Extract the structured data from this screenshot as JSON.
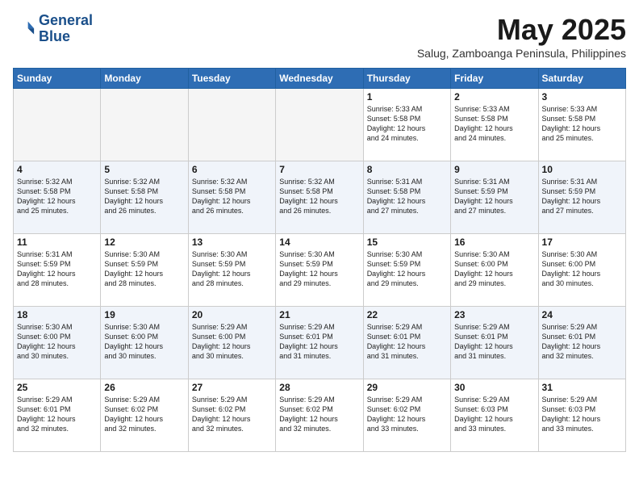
{
  "logo": {
    "line1": "General",
    "line2": "Blue"
  },
  "title": "May 2025",
  "subtitle": "Salug, Zamboanga Peninsula, Philippines",
  "days_of_week": [
    "Sunday",
    "Monday",
    "Tuesday",
    "Wednesday",
    "Thursday",
    "Friday",
    "Saturday"
  ],
  "weeks": [
    [
      {
        "day": "",
        "detail": ""
      },
      {
        "day": "",
        "detail": ""
      },
      {
        "day": "",
        "detail": ""
      },
      {
        "day": "",
        "detail": ""
      },
      {
        "day": "1",
        "detail": "Sunrise: 5:33 AM\nSunset: 5:58 PM\nDaylight: 12 hours\nand 24 minutes."
      },
      {
        "day": "2",
        "detail": "Sunrise: 5:33 AM\nSunset: 5:58 PM\nDaylight: 12 hours\nand 24 minutes."
      },
      {
        "day": "3",
        "detail": "Sunrise: 5:33 AM\nSunset: 5:58 PM\nDaylight: 12 hours\nand 25 minutes."
      }
    ],
    [
      {
        "day": "4",
        "detail": "Sunrise: 5:32 AM\nSunset: 5:58 PM\nDaylight: 12 hours\nand 25 minutes."
      },
      {
        "day": "5",
        "detail": "Sunrise: 5:32 AM\nSunset: 5:58 PM\nDaylight: 12 hours\nand 26 minutes."
      },
      {
        "day": "6",
        "detail": "Sunrise: 5:32 AM\nSunset: 5:58 PM\nDaylight: 12 hours\nand 26 minutes."
      },
      {
        "day": "7",
        "detail": "Sunrise: 5:32 AM\nSunset: 5:58 PM\nDaylight: 12 hours\nand 26 minutes."
      },
      {
        "day": "8",
        "detail": "Sunrise: 5:31 AM\nSunset: 5:58 PM\nDaylight: 12 hours\nand 27 minutes."
      },
      {
        "day": "9",
        "detail": "Sunrise: 5:31 AM\nSunset: 5:59 PM\nDaylight: 12 hours\nand 27 minutes."
      },
      {
        "day": "10",
        "detail": "Sunrise: 5:31 AM\nSunset: 5:59 PM\nDaylight: 12 hours\nand 27 minutes."
      }
    ],
    [
      {
        "day": "11",
        "detail": "Sunrise: 5:31 AM\nSunset: 5:59 PM\nDaylight: 12 hours\nand 28 minutes."
      },
      {
        "day": "12",
        "detail": "Sunrise: 5:30 AM\nSunset: 5:59 PM\nDaylight: 12 hours\nand 28 minutes."
      },
      {
        "day": "13",
        "detail": "Sunrise: 5:30 AM\nSunset: 5:59 PM\nDaylight: 12 hours\nand 28 minutes."
      },
      {
        "day": "14",
        "detail": "Sunrise: 5:30 AM\nSunset: 5:59 PM\nDaylight: 12 hours\nand 29 minutes."
      },
      {
        "day": "15",
        "detail": "Sunrise: 5:30 AM\nSunset: 5:59 PM\nDaylight: 12 hours\nand 29 minutes."
      },
      {
        "day": "16",
        "detail": "Sunrise: 5:30 AM\nSunset: 6:00 PM\nDaylight: 12 hours\nand 29 minutes."
      },
      {
        "day": "17",
        "detail": "Sunrise: 5:30 AM\nSunset: 6:00 PM\nDaylight: 12 hours\nand 30 minutes."
      }
    ],
    [
      {
        "day": "18",
        "detail": "Sunrise: 5:30 AM\nSunset: 6:00 PM\nDaylight: 12 hours\nand 30 minutes."
      },
      {
        "day": "19",
        "detail": "Sunrise: 5:30 AM\nSunset: 6:00 PM\nDaylight: 12 hours\nand 30 minutes."
      },
      {
        "day": "20",
        "detail": "Sunrise: 5:29 AM\nSunset: 6:00 PM\nDaylight: 12 hours\nand 30 minutes."
      },
      {
        "day": "21",
        "detail": "Sunrise: 5:29 AM\nSunset: 6:01 PM\nDaylight: 12 hours\nand 31 minutes."
      },
      {
        "day": "22",
        "detail": "Sunrise: 5:29 AM\nSunset: 6:01 PM\nDaylight: 12 hours\nand 31 minutes."
      },
      {
        "day": "23",
        "detail": "Sunrise: 5:29 AM\nSunset: 6:01 PM\nDaylight: 12 hours\nand 31 minutes."
      },
      {
        "day": "24",
        "detail": "Sunrise: 5:29 AM\nSunset: 6:01 PM\nDaylight: 12 hours\nand 32 minutes."
      }
    ],
    [
      {
        "day": "25",
        "detail": "Sunrise: 5:29 AM\nSunset: 6:01 PM\nDaylight: 12 hours\nand 32 minutes."
      },
      {
        "day": "26",
        "detail": "Sunrise: 5:29 AM\nSunset: 6:02 PM\nDaylight: 12 hours\nand 32 minutes."
      },
      {
        "day": "27",
        "detail": "Sunrise: 5:29 AM\nSunset: 6:02 PM\nDaylight: 12 hours\nand 32 minutes."
      },
      {
        "day": "28",
        "detail": "Sunrise: 5:29 AM\nSunset: 6:02 PM\nDaylight: 12 hours\nand 32 minutes."
      },
      {
        "day": "29",
        "detail": "Sunrise: 5:29 AM\nSunset: 6:02 PM\nDaylight: 12 hours\nand 33 minutes."
      },
      {
        "day": "30",
        "detail": "Sunrise: 5:29 AM\nSunset: 6:03 PM\nDaylight: 12 hours\nand 33 minutes."
      },
      {
        "day": "31",
        "detail": "Sunrise: 5:29 AM\nSunset: 6:03 PM\nDaylight: 12 hours\nand 33 minutes."
      }
    ]
  ]
}
